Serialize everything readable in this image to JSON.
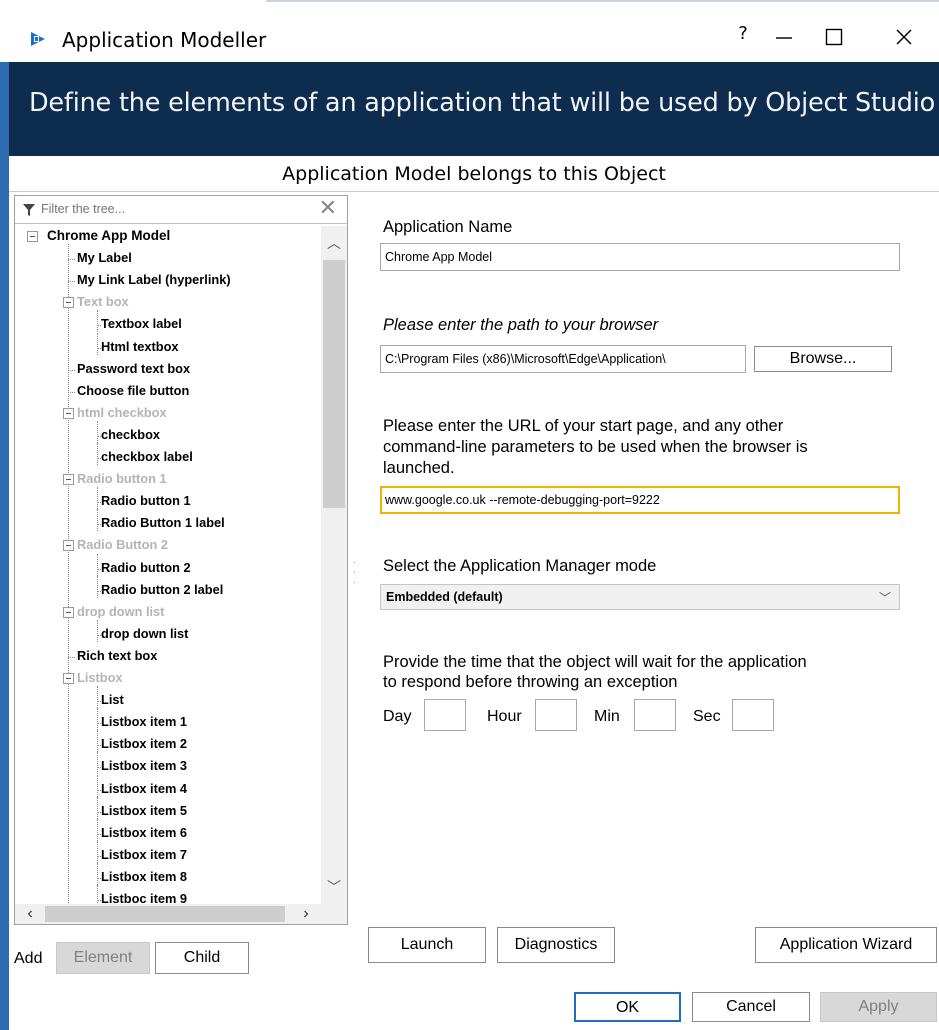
{
  "window": {
    "title": "Application Modeller",
    "help_glyph": "?",
    "min_glyph": "—",
    "max_glyph": "□",
    "close_glyph": "✕"
  },
  "banner": {
    "text": "Define the elements of an application that will be used by Object Studio",
    "background": "#0e2c4e"
  },
  "sub_header": "Application Model belongs to this Object",
  "tree": {
    "filter_placeholder": "Filter the tree...",
    "items": [
      {
        "label": "Chrome App Model",
        "level": 0,
        "expander": true,
        "greyed": false
      },
      {
        "label": "My Label",
        "level": 1,
        "expander": false,
        "greyed": false
      },
      {
        "label": "My Link Label (hyperlink)",
        "level": 1,
        "expander": false,
        "greyed": false
      },
      {
        "label": "Text box",
        "level": 1,
        "expander": true,
        "greyed": true
      },
      {
        "label": "Textbox label",
        "level": 2,
        "expander": false,
        "greyed": false
      },
      {
        "label": "Html textbox",
        "level": 2,
        "expander": false,
        "greyed": false
      },
      {
        "label": "Password text box",
        "level": 1,
        "expander": false,
        "greyed": false
      },
      {
        "label": "Choose file button",
        "level": 1,
        "expander": false,
        "greyed": false
      },
      {
        "label": "html checkbox",
        "level": 1,
        "expander": true,
        "greyed": true
      },
      {
        "label": "checkbox",
        "level": 2,
        "expander": false,
        "greyed": false
      },
      {
        "label": "checkbox label",
        "level": 2,
        "expander": false,
        "greyed": false
      },
      {
        "label": "Radio button 1",
        "level": 1,
        "expander": true,
        "greyed": true
      },
      {
        "label": "Radio button 1",
        "level": 2,
        "expander": false,
        "greyed": false
      },
      {
        "label": "Radio Button 1 label",
        "level": 2,
        "expander": false,
        "greyed": false
      },
      {
        "label": "Radio Button 2",
        "level": 1,
        "expander": true,
        "greyed": true
      },
      {
        "label": "Radio button 2",
        "level": 2,
        "expander": false,
        "greyed": false
      },
      {
        "label": "Radio button 2 label",
        "level": 2,
        "expander": false,
        "greyed": false
      },
      {
        "label": "drop down list",
        "level": 1,
        "expander": true,
        "greyed": true
      },
      {
        "label": "drop down list",
        "level": 2,
        "expander": false,
        "greyed": false
      },
      {
        "label": "Rich text box",
        "level": 1,
        "expander": false,
        "greyed": false
      },
      {
        "label": "Listbox",
        "level": 1,
        "expander": true,
        "greyed": true
      },
      {
        "label": "List",
        "level": 2,
        "expander": false,
        "greyed": false
      },
      {
        "label": "Listbox item 1",
        "level": 2,
        "expander": false,
        "greyed": false
      },
      {
        "label": "Listbox item 2",
        "level": 2,
        "expander": false,
        "greyed": false
      },
      {
        "label": "Listbox item 3",
        "level": 2,
        "expander": false,
        "greyed": false
      },
      {
        "label": "Listbox item 4",
        "level": 2,
        "expander": false,
        "greyed": false
      },
      {
        "label": "Listbox item 5",
        "level": 2,
        "expander": false,
        "greyed": false
      },
      {
        "label": "Listbox item 6",
        "level": 2,
        "expander": false,
        "greyed": false
      },
      {
        "label": "Listbox item 7",
        "level": 2,
        "expander": false,
        "greyed": false
      },
      {
        "label": "Listbox item 8",
        "level": 2,
        "expander": false,
        "greyed": false
      },
      {
        "label": "Listboc item 9",
        "level": 2,
        "expander": false,
        "greyed": false
      }
    ]
  },
  "add_bar": {
    "label": "Add",
    "element_button": "Element",
    "child_button": "Child"
  },
  "form": {
    "app_name_label": "Application Name",
    "app_name_value": "Chrome App Model",
    "browser_path_label": "Please enter the path to your browser",
    "browser_path_value": "C:\\Program Files (x86)\\Microsoft\\Edge\\Application\\",
    "browse_button": "Browse...",
    "url_label_line1": "Please enter the URL of your start page, and any other",
    "url_label_line2": "command-line parameters to be used when the browser is",
    "url_label_line3": "launched.",
    "url_value": "www.google.co.uk --remote-debugging-port=9222",
    "mode_label": "Select the Application Manager mode",
    "mode_value": "Embedded (default)",
    "timeout_label_line1": "Provide the time that the object will wait for the application",
    "timeout_label_line2": "to respond before throwing an exception",
    "day_label": "Day",
    "hour_label": "Hour",
    "min_label": "Min",
    "sec_label": "Sec"
  },
  "actions": {
    "launch": "Launch",
    "diagnostics": "Diagnostics",
    "wizard": "Application Wizard"
  },
  "footer": {
    "ok": "OK",
    "cancel": "Cancel",
    "apply": "Apply"
  },
  "colors": {
    "accent_blue": "#2b6cb0",
    "focus_border": "#f0b400",
    "greyed_text": "#b4b4b4"
  }
}
